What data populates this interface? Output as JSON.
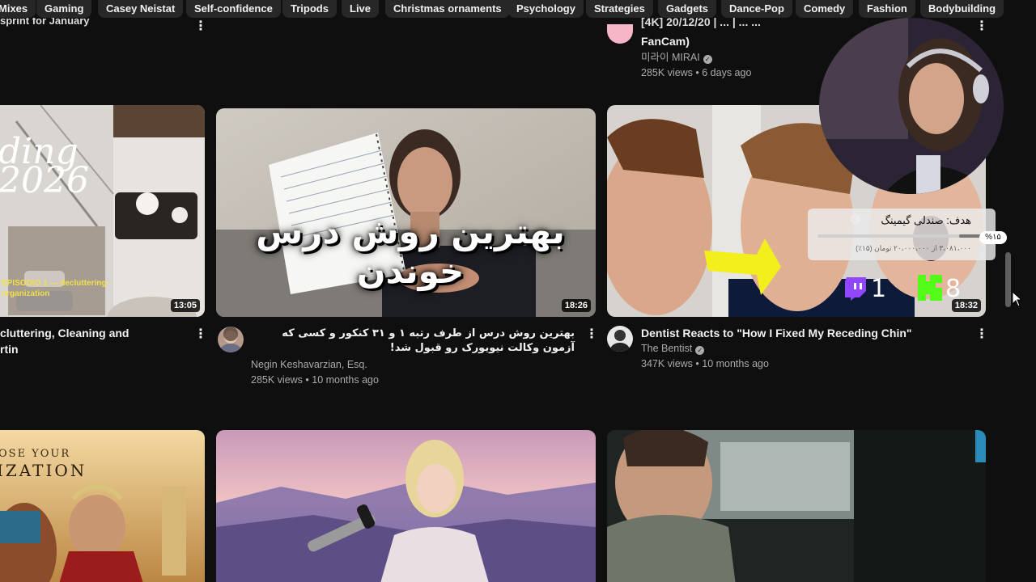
{
  "chips": [
    "Mixes",
    "Gaming",
    "Casey Neistat",
    "Self-confidence",
    "Tripods",
    "Live",
    "Christmas ornaments",
    "Psychology",
    "Strategies",
    "Gadgets",
    "Dance-Pop",
    "Comedy",
    "Fashion",
    "Bodybuilding"
  ],
  "top_row": {
    "left_title": "sprint for January",
    "right_title_line1": "[4K] 20/12/20 | ... | ... ...",
    "right_title_line2": "FanCam)",
    "right_channel": "미라이 MIRAI",
    "right_meta": "285K views • 6 days ago"
  },
  "videos": [
    {
      "overlay_text": "ding\n2026",
      "overlay_sub": "EPISODIO 1 — decluttering - organization",
      "duration": "13:05",
      "title_line1": "cluttering, Cleaning and",
      "title_line2": "rtin"
    },
    {
      "overlay_text": "بهترین روش درس خوندن",
      "duration": "18:26",
      "title": "بهترین روش درس از طرف رتبه ۱ و ۳۱ کنکور و کسی که آزمون وکالت نیویورک رو قبول شد!",
      "channel": "Negin Keshavarzian, Esq.",
      "meta": "285K views • 10 months ago"
    },
    {
      "duration": "18:32",
      "title": "Dentist Reacts to \"How I Fixed My Receding Chin\"",
      "channel": "The Bentist",
      "meta": "347K views • 10 months ago"
    }
  ],
  "bottom_row": {
    "left_overlay_line1": "OSE YOUR",
    "left_overlay_line2": "IZATION"
  },
  "stream_overlay": {
    "goal_title": "هدف: صندلی گیمینگ",
    "goal_amount": "۳،۰۸۱،۰۰۰ از ۲۰،۰۰۰،۰۰۰ تومان (۱۵٪)",
    "goal_percent_label": "%۱۵",
    "goal_progress": 0.15,
    "twitch_count": "1",
    "kick_count": "8"
  }
}
